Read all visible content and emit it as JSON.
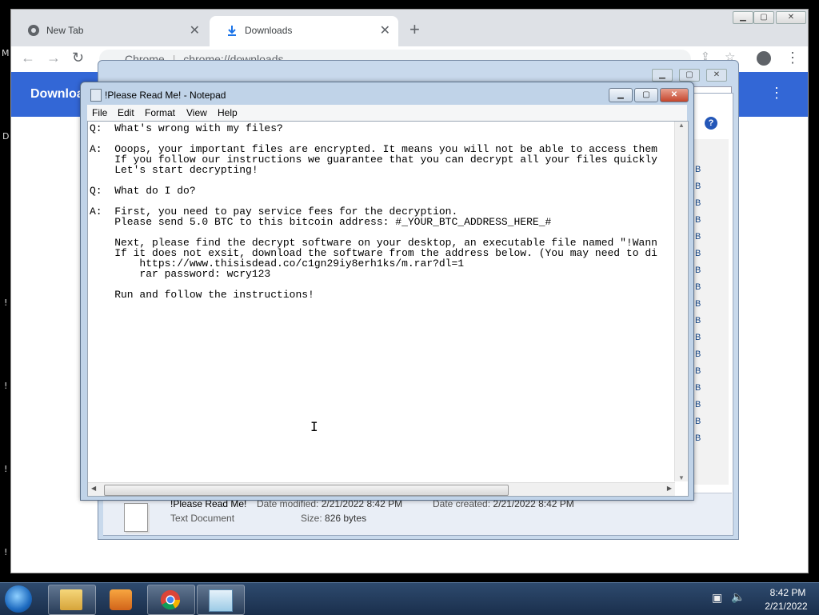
{
  "chrome": {
    "tabs": [
      {
        "label": "New Tab"
      },
      {
        "label": "Downloads"
      }
    ],
    "omnibox_prefix": "Chrome",
    "omnibox_url": "chrome://downloads",
    "downloads_title": "Downloads"
  },
  "explorer": {
    "file_name": "!Please Read Me!",
    "file_type": "Text Document",
    "date_modified_label": "Date modified:",
    "date_modified": "2/21/2022 8:42 PM",
    "date_created_label": "Date created:",
    "date_created": "2/21/2022 8:42 PM",
    "size_label": "Size:",
    "size": "826 bytes",
    "size_column": [
      "B",
      "B",
      "B",
      "B",
      "B",
      "B",
      "B",
      "B",
      "B",
      "B",
      "B",
      "B",
      "B",
      "B",
      "B",
      "B",
      "B"
    ]
  },
  "notepad": {
    "title": "!Please Read Me! - Notepad",
    "menu": [
      "File",
      "Edit",
      "Format",
      "View",
      "Help"
    ],
    "content": "Q:  What's wrong with my files?\n\nA:  Ooops, your important files are encrypted. It means you will not be able to access them\n    If you follow our instructions we guarantee that you can decrypt all your files quickly\n    Let's start decrypting!\n\nQ:  What do I do?\n\nA:  First, you need to pay service fees for the decryption.\n    Please send 5.0 BTC to this bitcoin address: #_YOUR_BTC_ADDRESS_HERE_#\n\n    Next, please find the decrypt software on your desktop, an executable file named \"!Wann\n    If it does not exsit, download the software from the address below. (You may need to di\n        https://www.thisisdead.co/c1gn29iy8erh1ks/m.rar?dl=1\n        rar password: wcry123\n\n    Run and follow the instructions!"
  },
  "taskbar": {
    "time": "8:42 PM",
    "date": "2/21/2022"
  },
  "desktop_fragments": [
    "M",
    "D",
    "!",
    "!",
    "!",
    "!"
  ],
  "colors": {
    "chrome_header": "#3367d6",
    "taskbar": "#1a2f4c",
    "notepad_frame": "#c0d3e8"
  }
}
